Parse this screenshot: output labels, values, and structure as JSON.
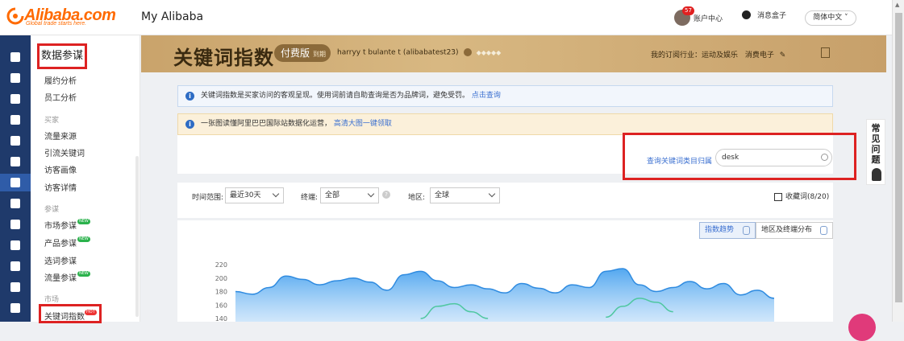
{
  "header": {
    "logo_text": "Alibaba.com",
    "logo_tagline": "Global trade starts here.",
    "my_alibaba": "My Alibaba",
    "message_count": "57",
    "account_center": "账户中心",
    "message_box": "消息盒子",
    "language": "简体中文"
  },
  "sidebar": {
    "title": "数据参谋",
    "top_items": [
      "履约分析",
      "员工分析"
    ],
    "groups": [
      {
        "label": "买家",
        "items": [
          "流量来源",
          "引流关键词",
          "访客画像",
          "访客详情"
        ]
      },
      {
        "label": "参谋",
        "items": [
          "市场参谋",
          "产品参谋",
          "选词参谋",
          "流量参谋"
        ]
      },
      {
        "label": "市场",
        "items": [
          "关键词指数"
        ]
      }
    ],
    "new_tag": "NEW",
    "hot_tag": "HOT"
  },
  "banner": {
    "title": "关键词指数",
    "edition": "付费版",
    "expiry": "到期",
    "user": "harryy t bulante t (alibabatest23)",
    "industry_label": "我的订阅行业：运动及娱乐",
    "industry_value": "消费电子"
  },
  "notices": [
    {
      "text": "关键词指数是买家访问的客观呈现。使用词前请自助查询是否为品牌词，避免受罚。",
      "link": "点击查询"
    },
    {
      "text": "一张图读懂阿里巴巴国际站数据化运营，",
      "link": "高清大图一键领取"
    }
  ],
  "search": {
    "label": "查询关键词类目归属",
    "value": "desk"
  },
  "filters": {
    "time_label": "时间范围:",
    "time_value": "最近30天",
    "terminal_label": "终端:",
    "terminal_value": "全部",
    "region_label": "地区:",
    "region_value": "全球",
    "favorites": "收藏词(8/20)"
  },
  "tabs": {
    "trend": "指数趋势",
    "distribution": "地区及终端分布"
  },
  "faq": [
    "常",
    "见",
    "问",
    "题"
  ],
  "colors": {
    "accent_blue": "#3a6fd0",
    "banner_gold": "#c9a36b",
    "highlight_red": "#dd2222",
    "nav_dark": "#1f3a6b"
  },
  "chart_data": {
    "type": "area",
    "y_ticks": [
      "220",
      "200",
      "180",
      "160",
      "140"
    ],
    "ylim": [
      130,
      225
    ],
    "series": [
      {
        "values": [
          180,
          176,
          186,
          203,
          198,
          190,
          196,
          200,
          194,
          182,
          205,
          210,
          196,
          186,
          190,
          184,
          178,
          192,
          185,
          178,
          190,
          186,
          210,
          214,
          190,
          180,
          186,
          195,
          184,
          192,
          175,
          182,
          170
        ]
      },
      {
        "values": [
          null,
          null,
          null,
          null,
          null,
          null,
          null,
          null,
          null,
          null,
          null,
          140,
          158,
          162,
          150,
          140,
          null,
          null,
          null,
          null,
          null,
          null,
          142,
          158,
          170,
          164,
          150,
          null,
          null,
          null,
          null,
          null,
          null
        ]
      }
    ]
  }
}
